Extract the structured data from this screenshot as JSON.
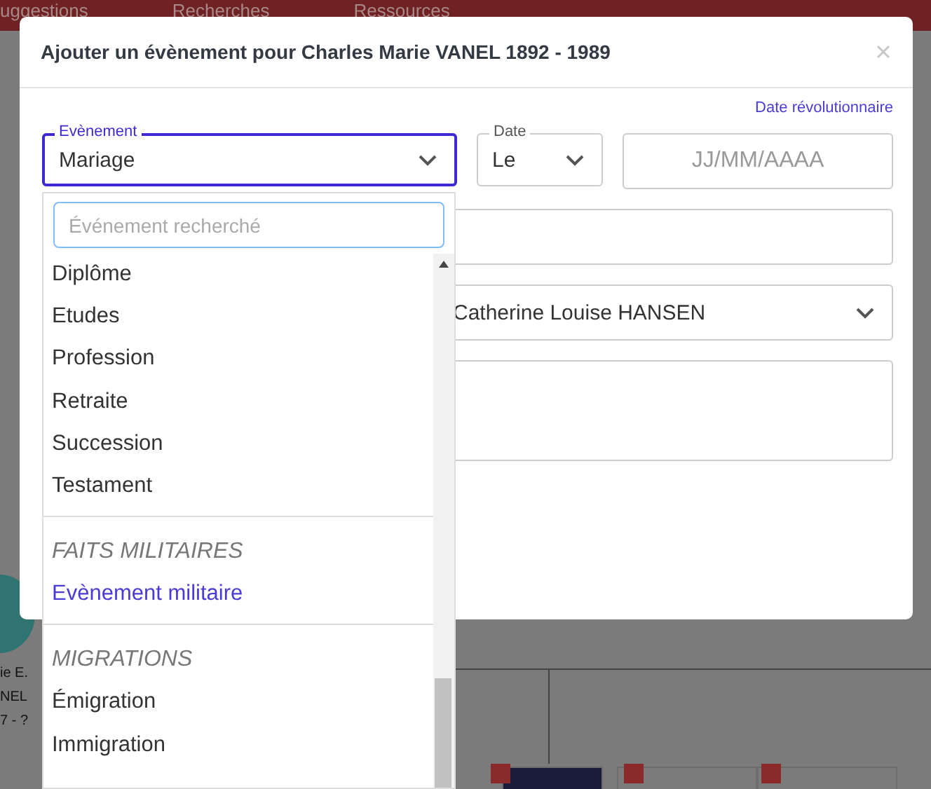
{
  "nav": {
    "items": [
      "uggestions",
      "Recherches",
      "Ressources"
    ]
  },
  "tree_fragment": {
    "texts": [
      "ie E.",
      "NEL",
      "7 - ?"
    ]
  },
  "modal": {
    "title": "Ajouter un évènement pour Charles Marie VANEL 1892 - 1989",
    "revolutionary_date_link": "Date révolutionnaire",
    "event_select": {
      "label": "Evènement",
      "value": "Mariage",
      "focused": true
    },
    "date_select": {
      "label": "Date",
      "value": "Le"
    },
    "date_input": {
      "placeholder": "JJ/MM/AAAA"
    },
    "partner_select": {
      "value": "Catherine Louise HANSEN"
    }
  },
  "dropdown": {
    "search": {
      "placeholder": "Événement recherché"
    },
    "groups": [
      {
        "items": [
          {
            "label": "Diplôme",
            "highlighted": false
          },
          {
            "label": "Etudes",
            "highlighted": false
          },
          {
            "label": "Profession",
            "highlighted": false
          },
          {
            "label": "Retraite",
            "highlighted": false
          },
          {
            "label": "Succession",
            "highlighted": false
          },
          {
            "label": "Testament",
            "highlighted": false
          }
        ]
      },
      {
        "title": "FAITS MILITAIRES",
        "items": [
          {
            "label": "Evènement militaire",
            "highlighted": true
          }
        ]
      },
      {
        "title": "MIGRATIONS",
        "items": [
          {
            "label": "Émigration",
            "highlighted": false
          },
          {
            "label": "Immigration",
            "highlighted": false
          }
        ]
      }
    ]
  }
}
